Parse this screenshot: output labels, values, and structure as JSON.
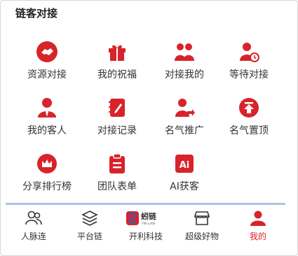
{
  "section": {
    "title": "链客对接"
  },
  "accent_color": "#d8232a",
  "menu_items": [
    {
      "label": "资源对接",
      "icon": "handshake-icon"
    },
    {
      "label": "我的祝福",
      "icon": "gift-icon"
    },
    {
      "label": "对接我的",
      "icon": "people-icon"
    },
    {
      "label": "等待对接",
      "icon": "person-clock-icon"
    },
    {
      "label": "我的客人",
      "icon": "person-tie-icon"
    },
    {
      "label": "对接记录",
      "icon": "notebook-pen-icon"
    },
    {
      "label": "名气推广",
      "icon": "person-share-icon"
    },
    {
      "label": "名气置顶",
      "icon": "arrow-top-icon"
    },
    {
      "label": "分享排行榜",
      "icon": "crown-icon"
    },
    {
      "label": "团队表单",
      "icon": "clipboard-icon"
    },
    {
      "label": "AI获客",
      "icon": "ai-icon"
    }
  ],
  "tabbar": {
    "items": [
      {
        "label": "人脉连",
        "icon": "contacts-icon",
        "active": false
      },
      {
        "label": "平台链",
        "icon": "layers-icon",
        "active": false
      },
      {
        "label": "开利科技",
        "icon": "brand-logo-icon",
        "active": false,
        "logo_text": "蚓链",
        "logo_sub": "YIN LIAN"
      },
      {
        "label": "超级好物",
        "icon": "shop-icon",
        "active": false
      },
      {
        "label": "我的",
        "icon": "user-icon",
        "active": true
      }
    ]
  }
}
